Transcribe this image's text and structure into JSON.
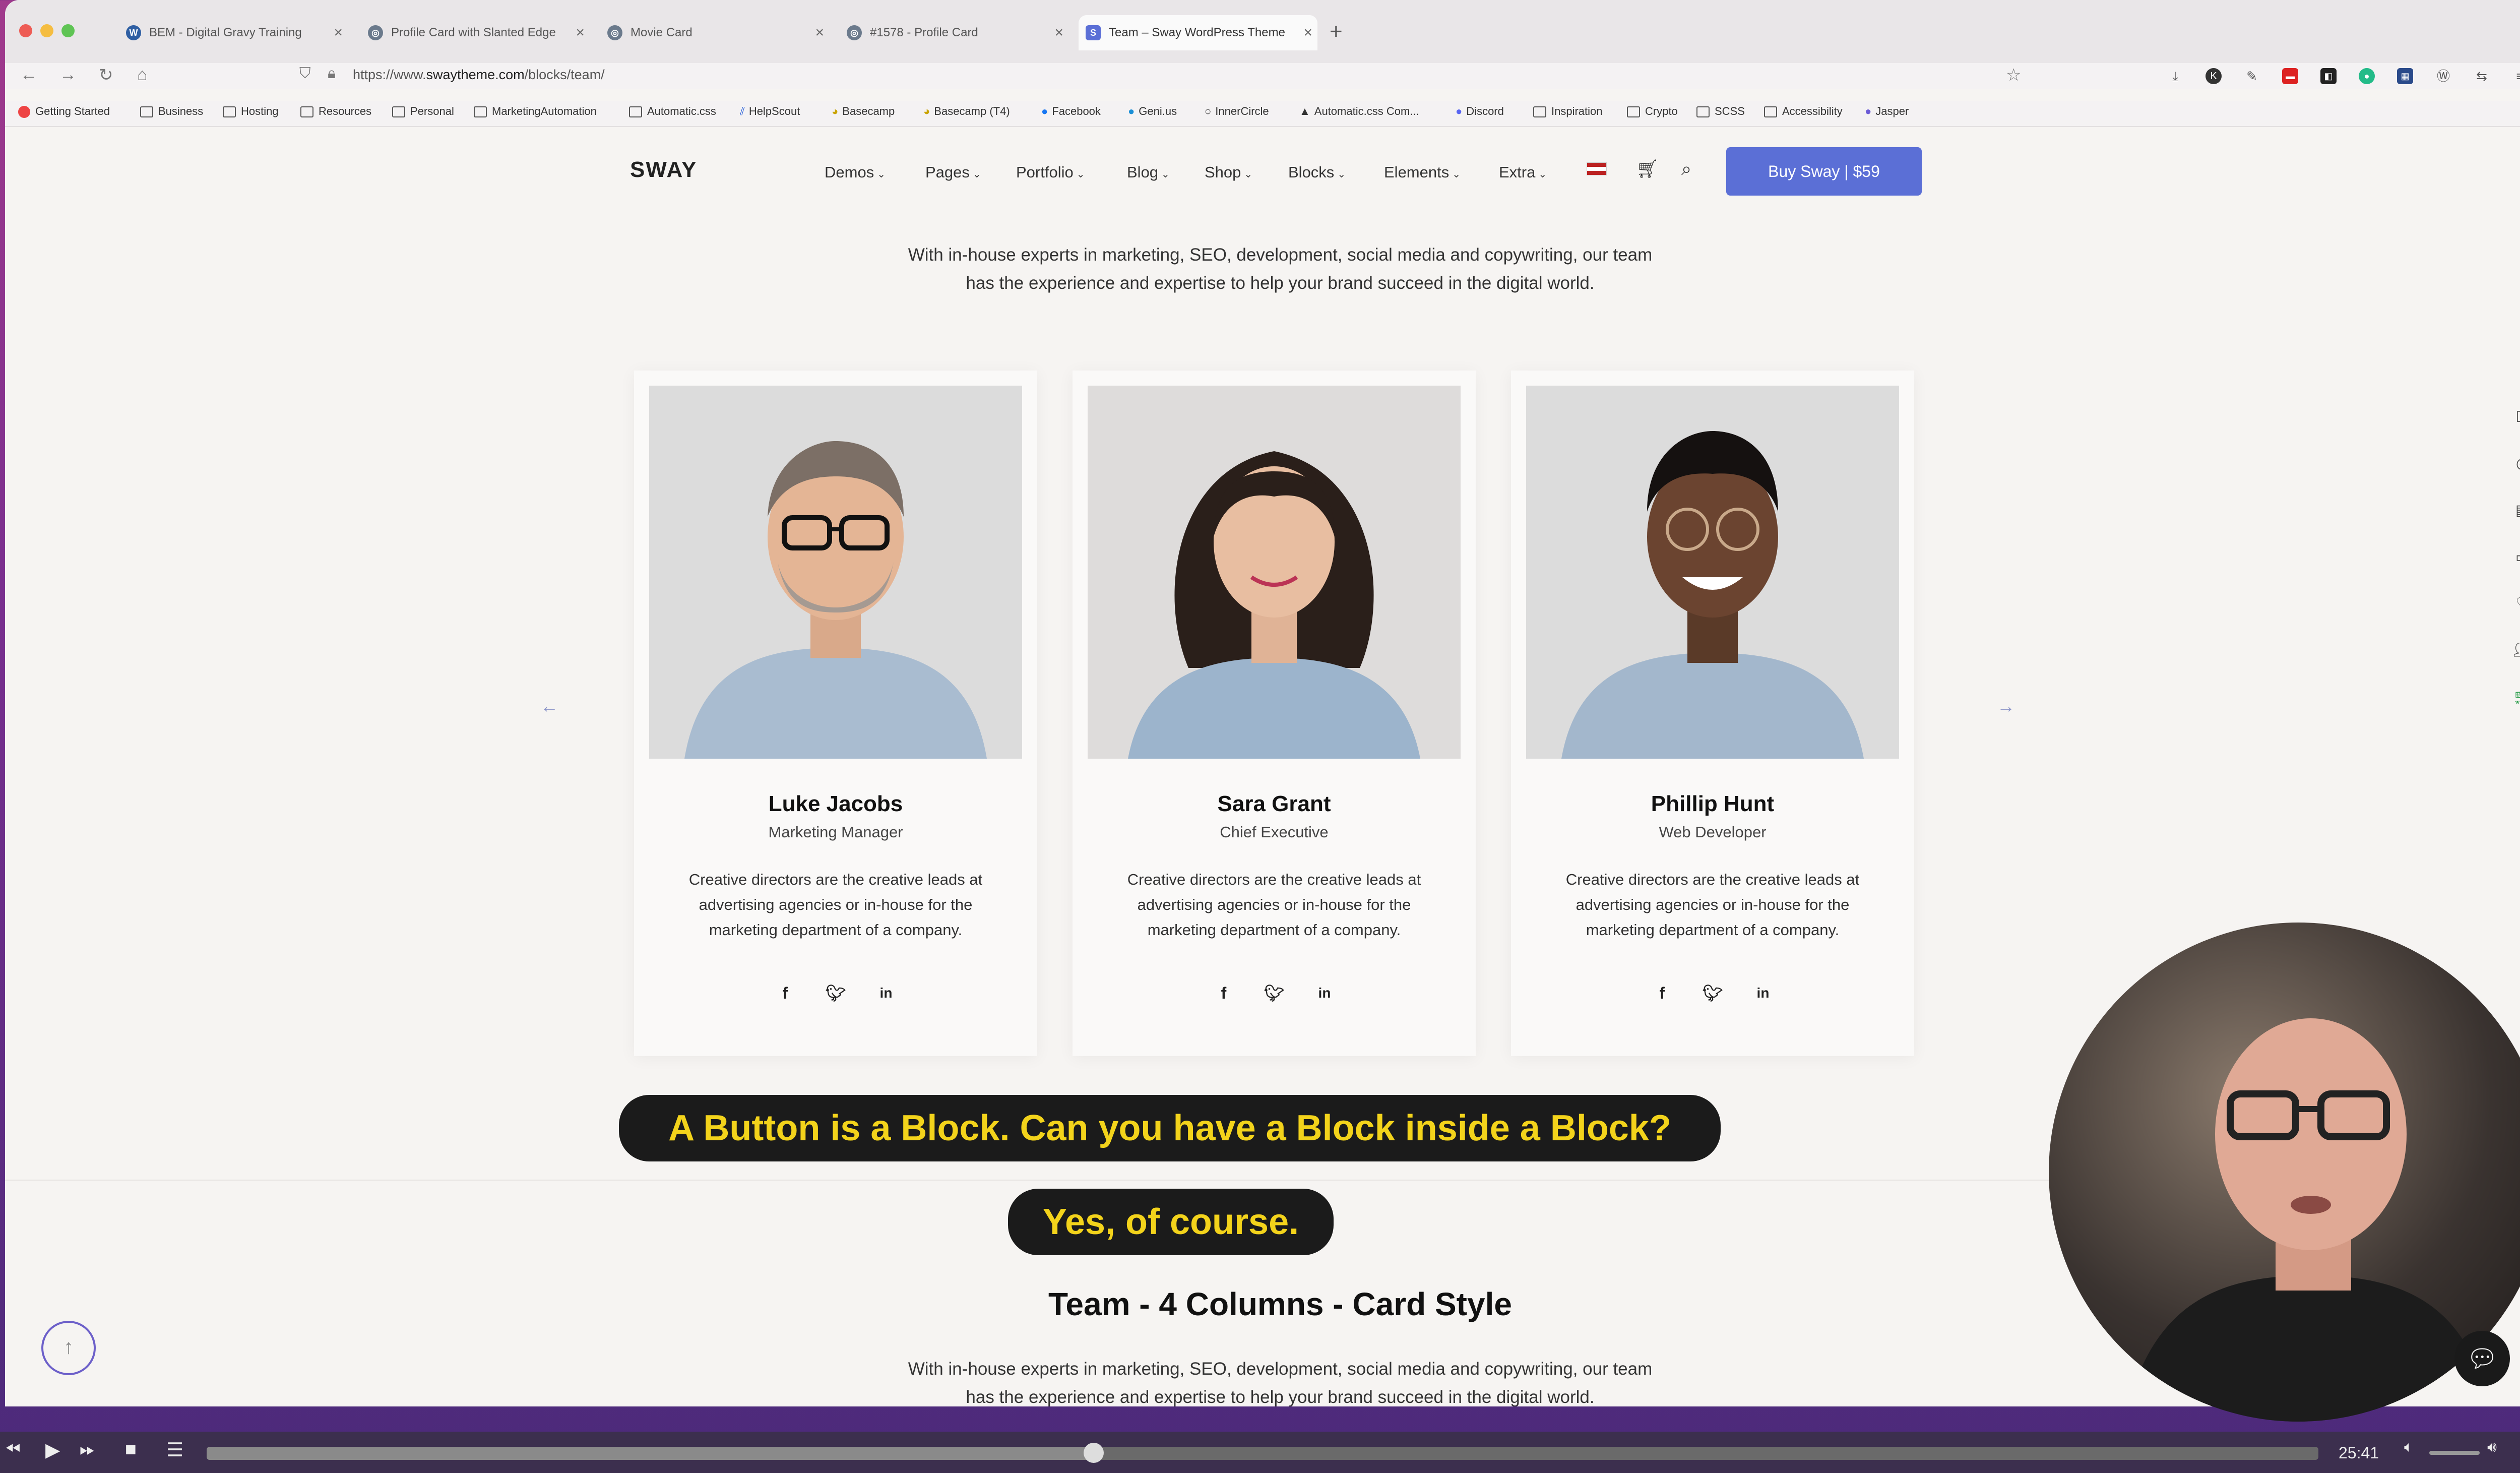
{
  "browser": {
    "tabs": [
      {
        "label": "BEM - Digital Gravy Training"
      },
      {
        "label": "Profile Card with Slanted Edge"
      },
      {
        "label": "Movie Card"
      },
      {
        "label": "#1578 - Profile Card"
      },
      {
        "label": "Team – Sway WordPress Theme"
      }
    ],
    "url_prefix": "https://www.",
    "url_host": "swaytheme.com",
    "url_path": "/blocks/team/",
    "bookmarks": [
      "Getting Started",
      "Business",
      "Hosting",
      "Resources",
      "Personal",
      "MarketingAutomation",
      "Automatic.css",
      "HelpScout",
      "Basecamp",
      "Basecamp (T4)",
      "Facebook",
      "Geni.us",
      "InnerCircle",
      "Automatic.css Com...",
      "Discord",
      "Inspiration",
      "Crypto",
      "SCSS",
      "Accessibility",
      "Jasper"
    ]
  },
  "site": {
    "logo": "SWAY",
    "menu": [
      "Demos",
      "Pages",
      "Portfolio",
      "Blog",
      "Shop",
      "Blocks",
      "Elements",
      "Extra"
    ],
    "buy_label": "Buy Sway | $59",
    "intro_line1": "With in-house experts in marketing, SEO, development, social media and copywriting, our team",
    "intro_line2": "has the experience and expertise to help your brand succeed in the digital world."
  },
  "team": [
    {
      "name": "Luke Jacobs",
      "role": "Marketing Manager",
      "desc": "Creative directors are the creative leads at advertising agencies or in-house for the marketing department of a company."
    },
    {
      "name": "Sara Grant",
      "role": "Chief Executive",
      "desc": "Creative directors are the creative leads at advertising agencies or in-house for the marketing department of a company."
    },
    {
      "name": "Phillip Hunt",
      "role": "Web Developer",
      "desc": "Creative directors are the creative leads at advertising agencies or in-house for the marketing department of a company."
    }
  ],
  "captions": {
    "line1": "A Button is a Block. Can you have a Block inside a Block?",
    "line2": "Yes, of course."
  },
  "section2": {
    "title": "Team - 4 Columns - Card Style",
    "intro_line1": "With in-house experts in marketing, SEO, development, social media and copywriting, our team",
    "intro_line2": "has the experience and expertise to help your brand succeed in the digital world."
  },
  "player": {
    "time": "25:41",
    "progress": 0.42
  },
  "colors": {
    "accent": "#5b6fd6",
    "caption_text": "#f3d31b",
    "caption_bg": "#1b1b1b"
  }
}
